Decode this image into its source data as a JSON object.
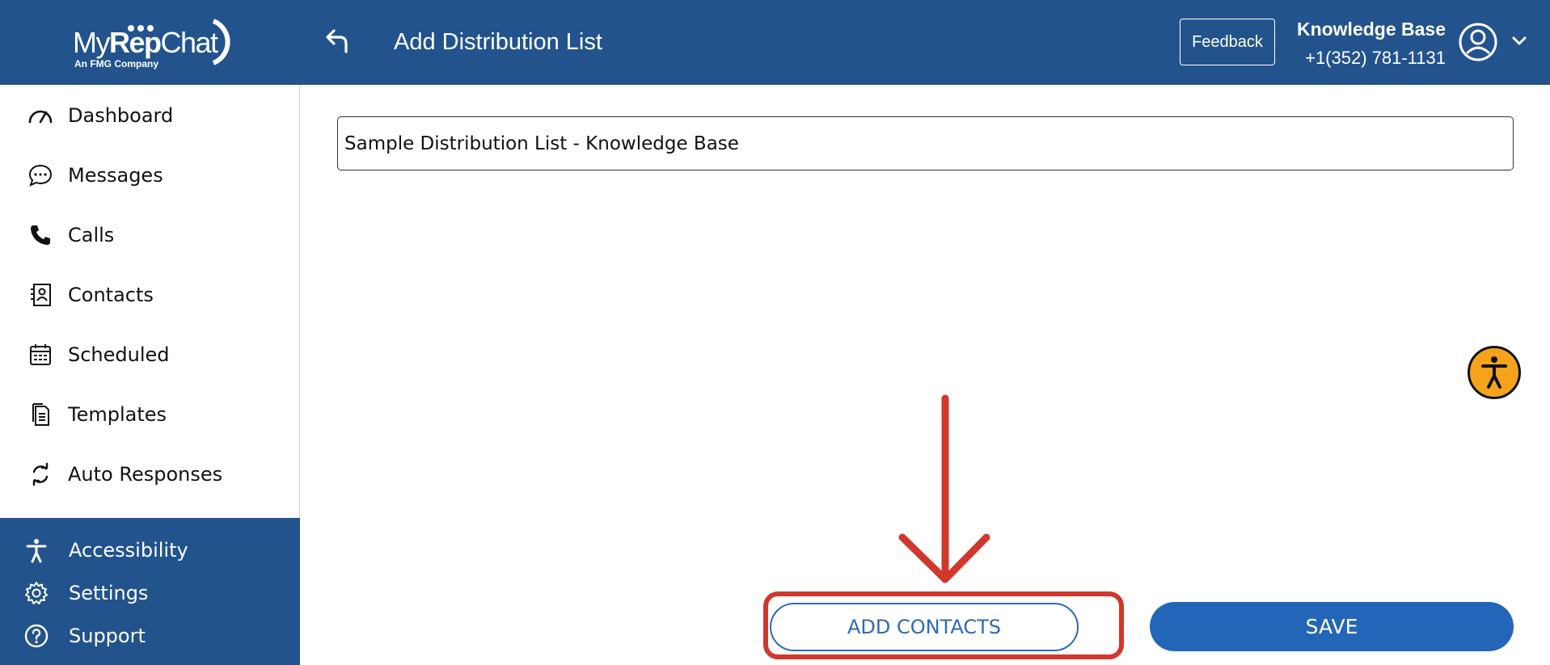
{
  "brand": {
    "logo_name_light": "My",
    "logo_name_bold": "Rep",
    "logo_name_end": "Chat",
    "logo_tagline": "An FMG Company"
  },
  "header": {
    "title": "Add Distribution List",
    "feedback_label": "Feedback",
    "user_name": "Knowledge Base",
    "user_phone": "+1(352) 781-1131"
  },
  "sidebar": {
    "items": [
      {
        "label": "Dashboard",
        "icon": "speedometer-icon"
      },
      {
        "label": "Messages",
        "icon": "chat-bubble-icon"
      },
      {
        "label": "Calls",
        "icon": "phone-icon"
      },
      {
        "label": "Contacts",
        "icon": "contact-card-icon"
      },
      {
        "label": "Scheduled",
        "icon": "calendar-icon"
      },
      {
        "label": "Templates",
        "icon": "document-icon"
      },
      {
        "label": "Auto Responses",
        "icon": "refresh-icon"
      }
    ],
    "bottom_items": [
      {
        "label": "Accessibility",
        "icon": "accessibility-icon"
      },
      {
        "label": "Settings",
        "icon": "gear-icon"
      },
      {
        "label": "Support",
        "icon": "help-icon"
      }
    ]
  },
  "form": {
    "list_name_value": "Sample Distribution List - Knowledge Base"
  },
  "actions": {
    "add_contacts_label": "ADD CONTACTS",
    "save_label": "SAVE"
  },
  "colors": {
    "header_bg": "#22538d",
    "primary_button": "#2366b8",
    "highlight": "#d0382c",
    "accessibility_fab": "#f5a31b"
  }
}
